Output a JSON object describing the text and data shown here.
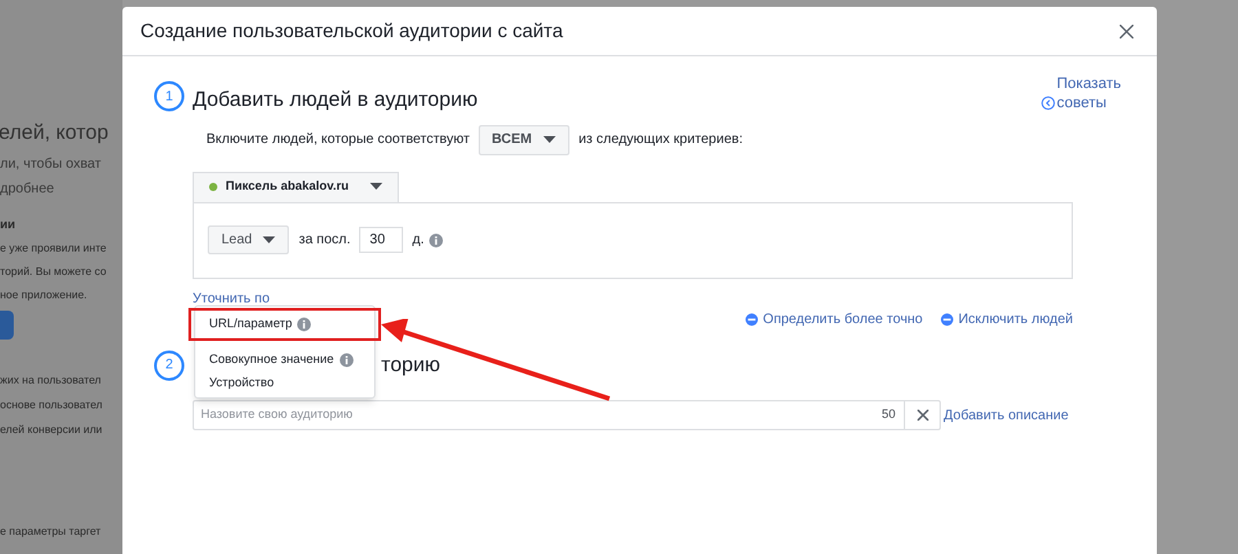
{
  "background_page": {
    "heading": "елей, котор",
    "lines": [
      "ли, чтобы охват",
      "дробнее"
    ],
    "subheading": "ии",
    "paragraph": [
      "е уже проявили инте",
      "торий. Вы можете со",
      "ное приложение."
    ],
    "paragraph_2": [
      "жих на пользовател",
      "основе пользовател",
      "елей конверсии или"
    ],
    "footer_line": "е параметры таргет"
  },
  "dialog": {
    "title": "Создание пользовательской аудитории с сайта",
    "step_1": {
      "number": "1",
      "title": "Добавить людей в аудиторию",
      "tips_link": [
        "Показать",
        "советы"
      ],
      "include_text": "Включите людей, которые соответствуют",
      "match_select": "ВСЕМ",
      "include_suffix": "из следующих критериев:",
      "source_tab": {
        "label": "Пиксель abakalov.ru",
        "color": "#7cb342"
      },
      "event_select": "Lead",
      "period_prefix": "за посл.",
      "days": "30",
      "period_suffix": "д.",
      "refine_link": "Уточнить по",
      "refine_menu": [
        {
          "label": "URL/параметр",
          "info": true,
          "highlighted": true
        },
        {
          "label": "Совокупное значение",
          "info": true,
          "highlighted": false
        },
        {
          "label": "Устройство",
          "info": false,
          "highlighted": false
        }
      ],
      "actions": [
        "Определить более точно",
        "Исключить людей"
      ]
    },
    "step_2": {
      "number": "2",
      "title": "торию",
      "name_placeholder": "Назовите свою аудиторию",
      "char_count": "50",
      "add_description": "Добавить описание"
    }
  }
}
